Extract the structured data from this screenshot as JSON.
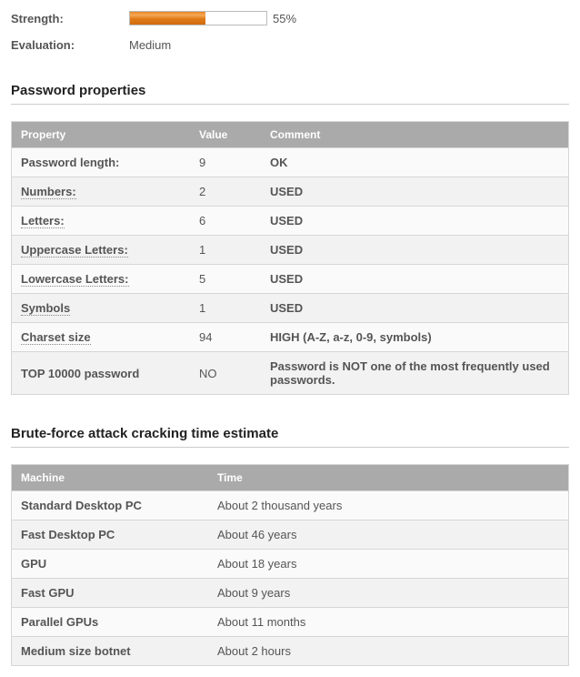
{
  "summary": {
    "strength_label": "Strength:",
    "strength_percent": "55%",
    "evaluation_label": "Evaluation:",
    "evaluation_value": "Medium"
  },
  "properties": {
    "title": "Password properties",
    "headers": {
      "property": "Property",
      "value": "Value",
      "comment": "Comment"
    },
    "rows": [
      {
        "name": "Password length:",
        "dotted": false,
        "value": "9",
        "comment": "OK"
      },
      {
        "name": "Numbers:",
        "dotted": true,
        "value": "2",
        "comment": "USED"
      },
      {
        "name": "Letters:",
        "dotted": true,
        "value": "6",
        "comment": "USED"
      },
      {
        "name": "Uppercase Letters:",
        "dotted": true,
        "value": "1",
        "comment": "USED"
      },
      {
        "name": "Lowercase Letters:",
        "dotted": true,
        "value": "5",
        "comment": "USED"
      },
      {
        "name": "Symbols",
        "dotted": true,
        "value": "1",
        "comment": "USED"
      },
      {
        "name": "Charset size",
        "dotted": true,
        "value": "94",
        "comment": "HIGH (A-Z, a-z, 0-9, symbols)"
      },
      {
        "name": "TOP 10000 password",
        "dotted": false,
        "value": "NO",
        "comment": "Password is NOT one of the most frequently used passwords."
      }
    ]
  },
  "crack": {
    "title": "Brute-force attack cracking time estimate",
    "headers": {
      "machine": "Machine",
      "time": "Time"
    },
    "rows": [
      {
        "machine": "Standard Desktop PC",
        "time": "About 2 thousand years"
      },
      {
        "machine": "Fast Desktop PC",
        "time": "About 46 years"
      },
      {
        "machine": "GPU",
        "time": "About 18 years"
      },
      {
        "machine": "Fast GPU",
        "time": "About 9 years"
      },
      {
        "machine": "Parallel GPUs",
        "time": "About 11 months"
      },
      {
        "machine": "Medium size botnet",
        "time": "About 2 hours"
      }
    ]
  }
}
